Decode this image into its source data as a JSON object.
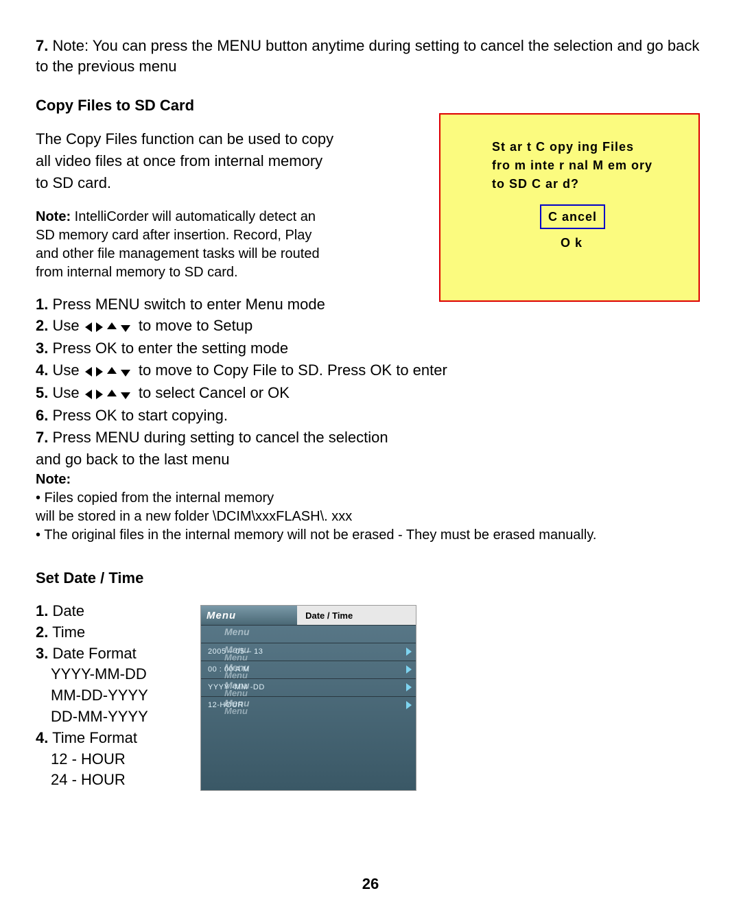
{
  "intro_step7_num": "7.",
  "intro_step7_text": " Note: You can press the MENU button anytime during setting to cancel the selection and go back to the previous menu",
  "sectionA_title": "Copy Files to SD Card",
  "copy_intro": "The Copy Files function can be used to copy all video files at once from internal memory to SD card.",
  "note_label": "Note:",
  "intellicorder_note": " IntelliCorder will automatically detect an SD memory card after insertion.  Record, Play and other file management tasks will be routed from internal memory to SD card.",
  "steps": {
    "s1n": "1.",
    "s1": " Press MENU switch to enter Menu mode",
    "s2n": "2.",
    "s2a": " Use",
    "s2b": "to move to Setup",
    "s3n": "3.",
    "s3": " Press OK to enter the setting mode",
    "s4n": "4.",
    "s4a": " Use",
    "s4b": "to move to Copy File to SD.  Press OK to enter",
    "s5n": "5.",
    "s5a": " Use",
    "s5b": "to select Cancel or OK",
    "s6n": "6.",
    "s6": " Press OK to start copying.",
    "s7n": "7.",
    "s7": " Press MENU during setting to cancel the selection",
    "s7_cont": "and go back to the last menu"
  },
  "notes_header": "Note:",
  "note_bullet1": "• Files copied from the internal memory",
  "note_bullet1_cont": "will be stored in a new folder \\DCIM\\xxxFLASH\\. xxx",
  "note_bullet2": "• The original files in the internal memory will not be erased - They must be erased manually.",
  "dialog": {
    "line1": "St ar t  C opy ing  Files",
    "line2": "fro m  inte r nal M  em ory",
    "line3": "to SD   C ar d?",
    "cancel": "C ancel",
    "ok": "O k"
  },
  "sectionB_title": "Set Date / Time",
  "dt": {
    "i1n": "1.",
    "i1": " Date",
    "i2n": "2.",
    "i2": " Time",
    "i3n": "3.",
    "i3": " Date Format",
    "f1": "YYYY-MM-DD",
    "f2": "MM-DD-YYYY",
    "f3": "DD-MM-YYYY",
    "i4n": "4.",
    "i4": " Time Format",
    "t1": "12 - HOUR",
    "t2": "24 - HOUR"
  },
  "menu_ui": {
    "tab_menu": "Menu",
    "tab_title": "Date / Time",
    "ghost": "Menu",
    "r1": "2005 – 05 – 13",
    "r2": "00 : 00   A M",
    "r3": "YYYY -MM -DD",
    "r4": "12-HOUR"
  },
  "page_number": "26"
}
